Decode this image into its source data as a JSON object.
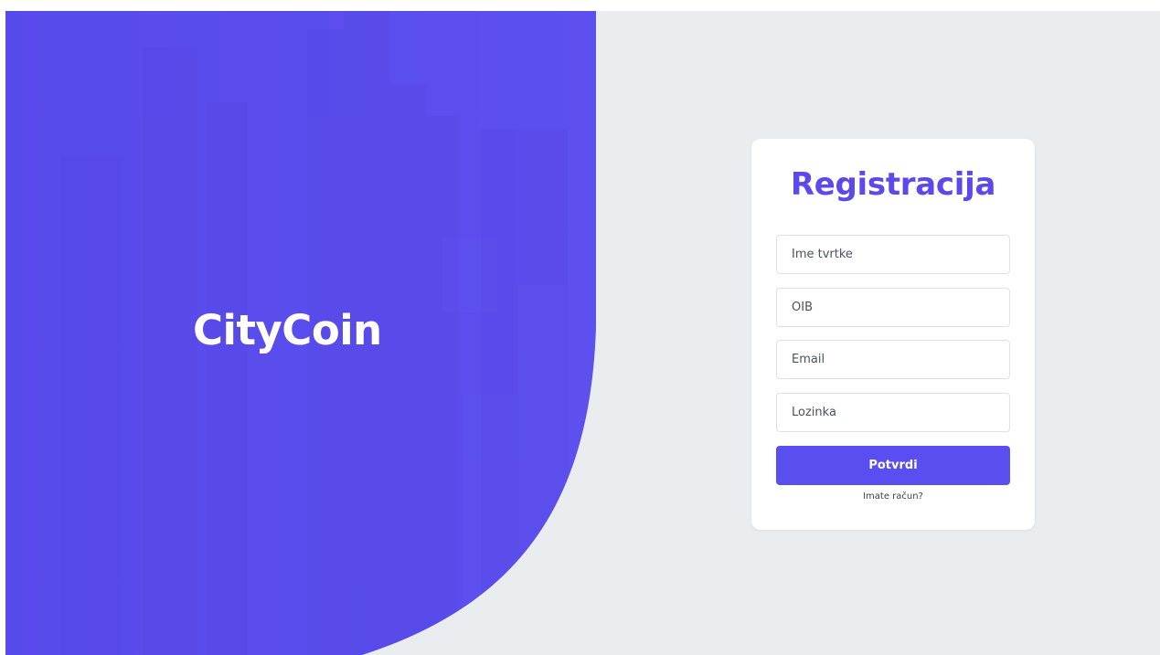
{
  "brand": {
    "name": "CityCoin"
  },
  "register_form": {
    "title": "Registracija",
    "fields": [
      {
        "placeholder": "Ime tvrtke",
        "value": ""
      },
      {
        "placeholder": "OIB",
        "value": ""
      },
      {
        "placeholder": "Email",
        "value": ""
      },
      {
        "placeholder": "Lozinka",
        "value": ""
      }
    ],
    "submit_label": "Potvrdi",
    "login_link": "Imate račun?"
  },
  "colors": {
    "accent": "#5b4ef0",
    "title": "#5b49ec",
    "hero_overlay": "#5a4ced",
    "page_background": "#e9edf0",
    "card_background": "#ffffff"
  },
  "hero_image": {
    "description_icon": "city-skyline-image"
  }
}
